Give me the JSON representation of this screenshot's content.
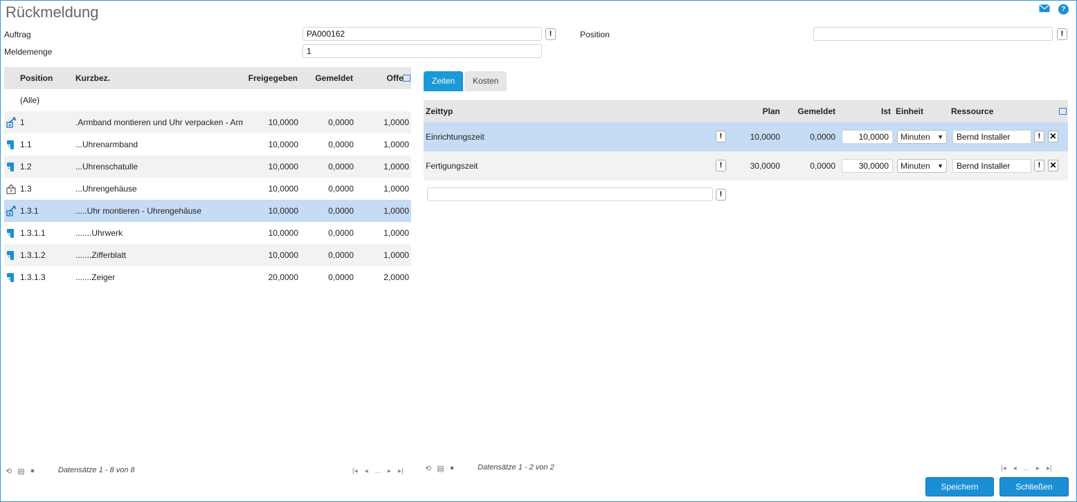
{
  "page": {
    "title": "Rückmeldung"
  },
  "form": {
    "auftrag_label": "Auftrag",
    "auftrag_value": "PA000162",
    "meldemenge_label": "Meldemenge",
    "meldemenge_value": "1",
    "position_label": "Position",
    "position_value": ""
  },
  "left_table": {
    "headers": {
      "position": "Position",
      "kurzbez": "Kurzbez.",
      "freigegeben": "Freigegeben",
      "gemeldet": "Gemeldet",
      "offen": "Offen"
    },
    "all_label": "(Alle)",
    "rows": [
      {
        "position": "1",
        "kurzbez": ".Armband montieren und Uhr verpacken - Arm",
        "freigegeben": "10,0000",
        "gemeldet": "0,0000",
        "offen": "1,0000",
        "icon": "operation-icon"
      },
      {
        "position": "1.1",
        "kurzbez": "...Uhrenarmband",
        "freigegeben": "10,0000",
        "gemeldet": "0,0000",
        "offen": "1,0000",
        "icon": "material-icon"
      },
      {
        "position": "1.2",
        "kurzbez": "...Uhrenschatulle",
        "freigegeben": "10,0000",
        "gemeldet": "0,0000",
        "offen": "1,0000",
        "icon": "material-icon"
      },
      {
        "position": "1.3",
        "kurzbez": "...Uhrengehäuse",
        "freigegeben": "10,0000",
        "gemeldet": "0,0000",
        "offen": "1,0000",
        "icon": "assembly-icon"
      },
      {
        "position": "1.3.1",
        "kurzbez": ".....Uhr montieren - Uhrengehäuse",
        "freigegeben": "10,0000",
        "gemeldet": "0,0000",
        "offen": "1,0000",
        "icon": "operation-icon"
      },
      {
        "position": "1.3.1.1",
        "kurzbez": ".......Uhrwerk",
        "freigegeben": "10,0000",
        "gemeldet": "0,0000",
        "offen": "1,0000",
        "icon": "material-icon"
      },
      {
        "position": "1.3.1.2",
        "kurzbez": ".......Zifferblatt",
        "freigegeben": "10,0000",
        "gemeldet": "0,0000",
        "offen": "1,0000",
        "icon": "material-icon"
      },
      {
        "position": "1.3.1.3",
        "kurzbez": ".......Zeiger",
        "freigegeben": "20,0000",
        "gemeldet": "0,0000",
        "offen": "2,0000",
        "icon": "material-icon"
      }
    ],
    "footer": "Datensätze 1 - 8 von 8",
    "pager_ellipsis": "..."
  },
  "tabs": [
    {
      "label": "Zeiten"
    },
    {
      "label": "Kosten"
    }
  ],
  "right_table": {
    "headers": {
      "zeittyp": "Zeittyp",
      "plan": "Plan",
      "gemeldet": "Gemeldet",
      "ist": "Ist",
      "einheit": "Einheit",
      "ressource": "Ressource"
    },
    "rows": [
      {
        "zeittyp": "Einrichtungszeit",
        "plan": "10,0000",
        "gemeldet": "0,0000",
        "ist": "10,0000",
        "einheit": "Minuten",
        "ressource": "Bernd Installer"
      },
      {
        "zeittyp": "Fertigungszeit",
        "plan": "30,0000",
        "gemeldet": "0,0000",
        "ist": "30,0000",
        "einheit": "Minuten",
        "ressource": "Bernd Installer"
      }
    ],
    "new_row_value": "",
    "footer": "Datensätze 1 - 2 von 2",
    "pager_ellipsis": "..."
  },
  "buttons": {
    "save": "Speichern",
    "close": "Schließen"
  },
  "colors": {
    "accent": "#1a9ad6",
    "selected_row": "#c6dcf5",
    "header_bg": "#e6e6e6"
  }
}
